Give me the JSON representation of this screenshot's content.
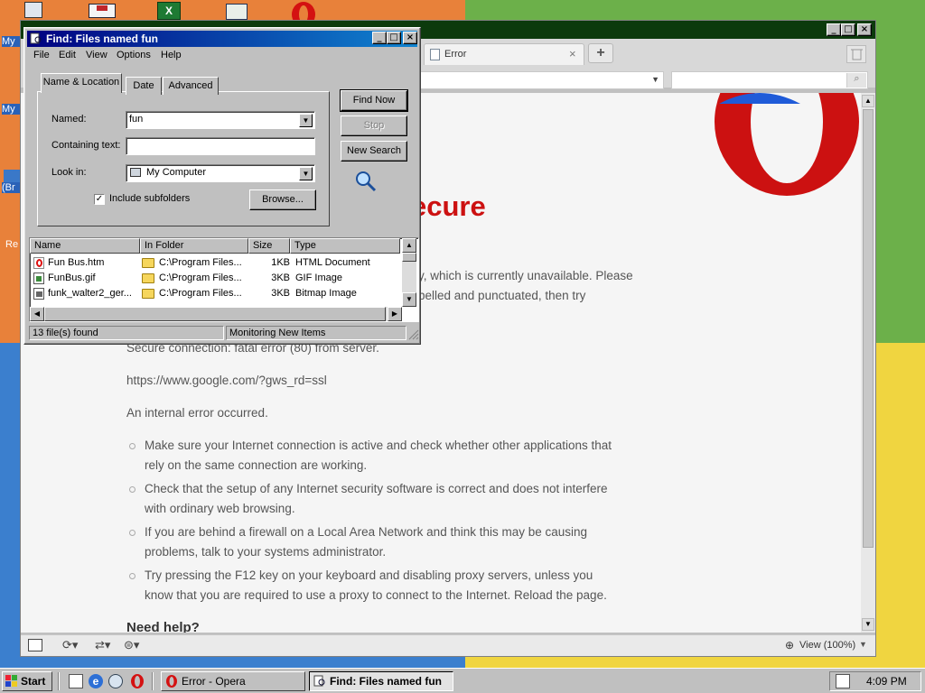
{
  "desktop": {
    "wallpaper_colors": [
      "#e8813a",
      "#6cb04a",
      "#3b7fce",
      "#f0d540"
    ],
    "left_labels": [
      "My",
      "My",
      "(Br",
      "Re"
    ],
    "top_icons": [
      "monitor-icon",
      "mail-icon",
      "excel-icon",
      "calendar-icon",
      "opera-icon"
    ]
  },
  "opera": {
    "tab_title": "Error",
    "zoom_label": "View (100%)",
    "heading_fragment": "ecure",
    "partial_lines": [
      "y, which is currently unavailable. Please",
      "pelled and punctuated, then try"
    ],
    "error_line": "Secure connection: fatal error (80) from server.",
    "url": "https://www.google.com/?gws_rd=ssl",
    "internal_error": "An internal error occurred.",
    "bullets": [
      [
        "Make sure your Internet connection is active and check whether other applications that",
        "rely on the same connection are working."
      ],
      [
        "Check that the setup of any Internet security software is correct and does not interfere",
        "with ordinary web browsing."
      ],
      [
        "If you are behind a firewall on a Local Area Network and think this may be causing",
        "problems, talk to your systems administrator."
      ],
      [
        "Try pressing the F12 key on your keyboard and disabling proxy servers, unless you",
        "know that you are required to use a proxy to connect to the Internet. Reload the page."
      ]
    ],
    "need_help": "Need help?",
    "brand_color": "#cc1111"
  },
  "find": {
    "title": "Find: Files named fun",
    "menu": [
      "File",
      "Edit",
      "View",
      "Options",
      "Help"
    ],
    "tabs": [
      "Name & Location",
      "Date",
      "Advanced"
    ],
    "labels": {
      "named": "Named:",
      "containing": "Containing text:",
      "look_in": "Look in:",
      "include_subfolders": "Include subfolders"
    },
    "values": {
      "named": "fun",
      "containing": "",
      "look_in": "My Computer",
      "include_subfolders": true
    },
    "buttons": {
      "find_now": "Find Now",
      "stop": "Stop",
      "new_search": "New Search",
      "browse": "Browse..."
    },
    "columns": [
      "Name",
      "In Folder",
      "Size",
      "Type"
    ],
    "results": [
      {
        "name": "Fun Bus.htm",
        "folder": "C:\\Program Files...",
        "size": "1KB",
        "type": "HTML Document",
        "icon": "opera-doc-icon"
      },
      {
        "name": "FunBus.gif",
        "folder": "C:\\Program Files...",
        "size": "3KB",
        "type": "GIF Image",
        "icon": "gif-file-icon"
      },
      {
        "name": "funk_walter2_ger...",
        "folder": "C:\\Program Files...",
        "size": "3KB",
        "type": "Bitmap Image",
        "icon": "bitmap-file-icon"
      }
    ],
    "status": {
      "count": "13 file(s) found",
      "monitor": "Monitoring New Items"
    }
  },
  "taskbar": {
    "start": "Start",
    "tasks": [
      "Error - Opera",
      "Find: Files named fun"
    ],
    "clock": "4:09 PM"
  }
}
